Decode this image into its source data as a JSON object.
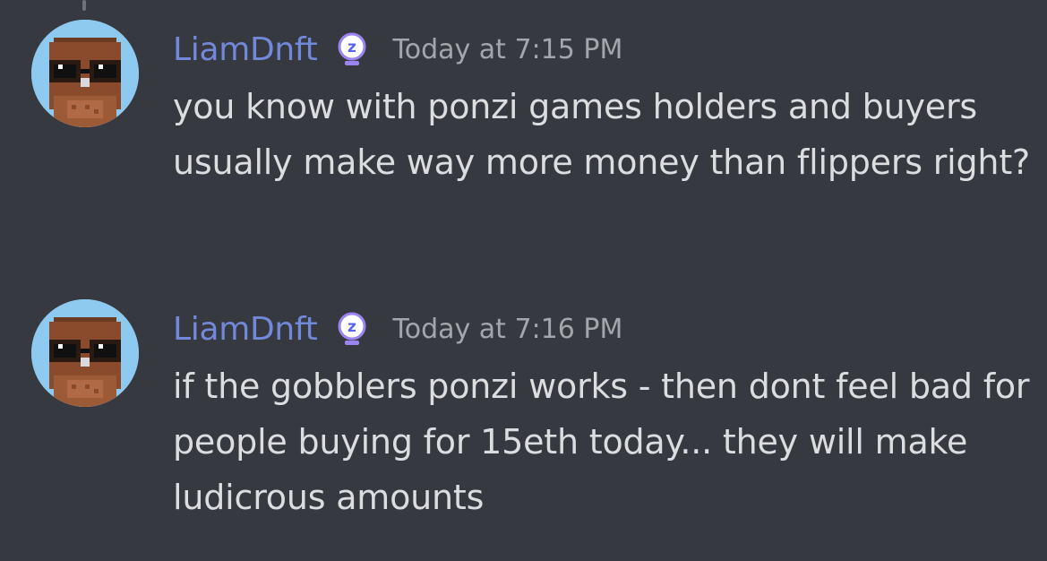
{
  "messages": [
    {
      "username": "LiamDnft",
      "timestamp": "Today at 7:15 PM",
      "text": "you know with ponzi games holders and buyers usually make way more money than flippers right?",
      "badge": "z-orb-icon",
      "avatar": "owl-avatar"
    },
    {
      "username": "LiamDnft",
      "timestamp": "Today at 7:16 PM",
      "text": "if the gobblers ponzi works - then dont feel bad for people buying for 15eth today... they will make ludicrous amounts",
      "badge": "z-orb-icon",
      "avatar": "owl-avatar"
    }
  ],
  "colors": {
    "background": "#36393f",
    "username": "#7289da",
    "timestamp": "#a3a6aa",
    "message_text": "#dcddde",
    "avatar_bg": "#8ec9f0",
    "badge": "#9b84ee"
  }
}
